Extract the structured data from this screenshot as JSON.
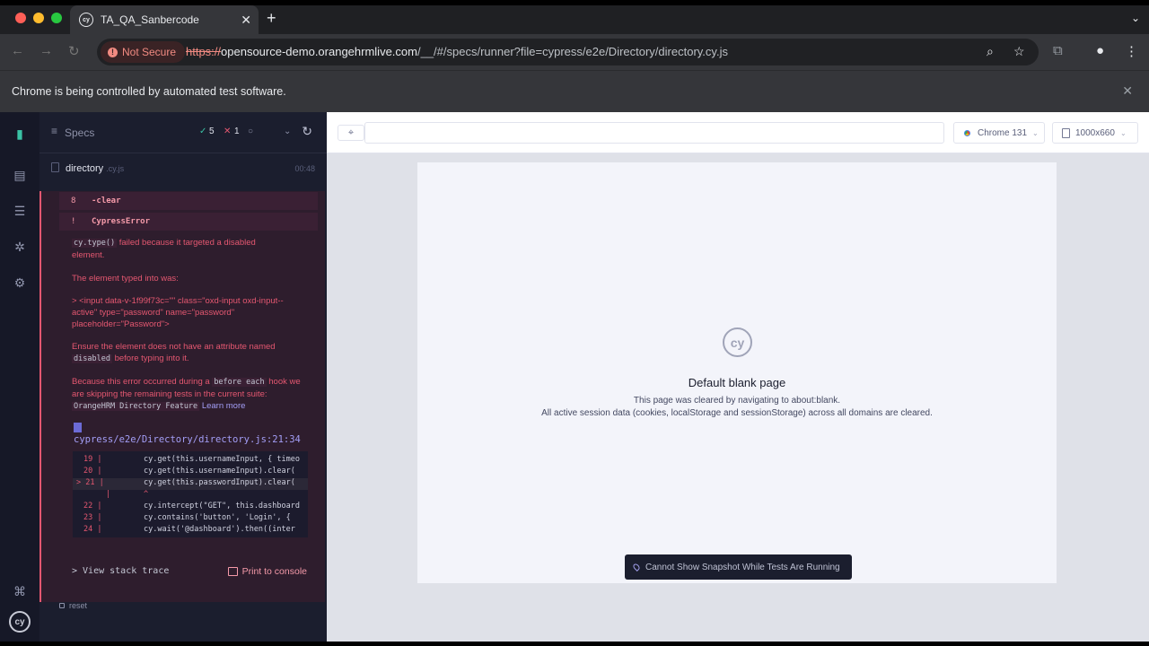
{
  "window": {
    "dot_colors": [
      "#fe5f57",
      "#febc2e",
      "#28c840"
    ],
    "tab_title": "TA_QA_Sanbercode",
    "favicon_text": "cy"
  },
  "toolbar": {
    "security_label": "Not Secure",
    "url_scheme": "https://",
    "url_host": "opensource-demo.orangehrmlive.com",
    "url_path": "/__/#/specs/runner?file=cypress/e2e/Directory/directory.cy.js"
  },
  "infobar": {
    "text": "Chrome is being controlled by automated test software."
  },
  "reporter": {
    "header": {
      "specs_label": "Specs",
      "passed": "5",
      "failed": "1",
      "pending": ""
    },
    "spec": {
      "name": "directory",
      "ext": ".cy.js",
      "duration": "00:48"
    },
    "commands": [
      {
        "number": "8",
        "text": "-clear"
      },
      {
        "number": "!",
        "text": "CypressError"
      }
    ],
    "error": {
      "p1_code": "cy.type()",
      "p1_text": " failed because it targeted a disabled element.",
      "p2": "The element typed into was:",
      "p3": "> <input data-v-1f99f73c=\"\" class=\"oxd-input oxd-input--active\" type=\"password\" name=\"password\" placeholder=\"Password\">",
      "p4_a": "Ensure the element does not have an attribute named ",
      "p4_code": "disabled",
      "p4_b": " before typing into it.",
      "p5_a": "Because this error occurred during a ",
      "p5_code1": "before each",
      "p5_b": " hook we are skipping the remaining tests in the current suite: ",
      "p5_code2": "OrangeHRM Directory Feature",
      "p5_link": "Learn more"
    },
    "file_link": "cypress/e2e/Directory/directory.js:21:34",
    "code_lines": [
      {
        "ln": "19 |",
        "code": "cy.get(this.usernameInput, { timeo"
      },
      {
        "ln": "20 |",
        "code": "cy.get(this.usernameInput).clear("
      },
      {
        "ln": "> 21 |",
        "code": "cy.get(this.passwordInput).clear("
      },
      {
        "ln": "|",
        "code": "                              ^"
      },
      {
        "ln": "22 |",
        "code": "cy.intercept(\"GET\", this.dashboard"
      },
      {
        "ln": "23 |",
        "code": "cy.contains('button', 'Login', {"
      },
      {
        "ln": "24 |",
        "code": "cy.wait('@dashboard').then((inter"
      }
    ],
    "stack_label": "> View stack trace",
    "print_label": "Print to console",
    "reset_label": "reset"
  },
  "aut": {
    "browser_label": "Chrome 131",
    "viewport_label": "1000x660",
    "blank_title": "Default blank page",
    "blank_line1": "This page was cleared by navigating to about:blank.",
    "blank_line2": "All active session data (cookies, localStorage and sessionStorage) across all domains are cleared.",
    "snapshot_msg": "Cannot Show Snapshot While Tests Are Running",
    "logo_text": "cy"
  },
  "colors": {
    "fail": "#e45770",
    "link": "#a39ef6",
    "reporter_bg": "#1b1e2e"
  }
}
